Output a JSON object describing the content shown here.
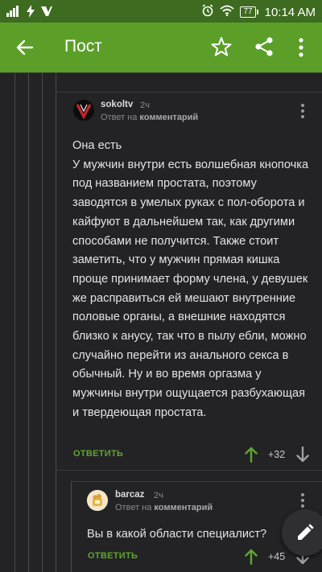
{
  "status_bar": {
    "battery": "77",
    "time": "10:14 AM"
  },
  "app_bar": {
    "title": "Пост"
  },
  "comments": [
    {
      "username": "sokoltv",
      "time": "2ч",
      "reply_prefix": "Ответ на",
      "reply_target": "комментарий",
      "text": "Она есть\nУ мужчин внутри есть волшебная кнопочка под названием простата, поэтому заводятся в умелых руках с пол-оборота и кайфуют в дальнейшем так, как другими способами не получится. Также стоит заметить, что у мужчин прямая кишка проще принимает форму члена, у девушек же расправиться ей мешают внутренние половые органы, а внешние находятся близко к анусу, так что в пылу ебли, можно случайно перейти из анального секса в обычный. Ну и во время оргазма у мужчины внутри ощущается разбухающая и твердеющая простата.",
      "reply_label": "ОТВЕТИТЬ",
      "score": "+32"
    },
    {
      "username": "barcaz",
      "time": "2ч",
      "reply_prefix": "Ответ на",
      "reply_target": "комментарий",
      "text": "Вы в какой области специалист?",
      "reply_label": "ОТВЕТИТЬ",
      "score": "+45"
    }
  ],
  "colors": {
    "status_bar": "#3d6b1f",
    "app_bar": "#5b9f29",
    "background": "#232325",
    "accent": "#5fa62d"
  },
  "icons": {
    "back": "arrow-left-icon",
    "bookmark": "star-outline-icon",
    "share": "share-icon",
    "menu": "more-vertical-icon",
    "fab": "pencil-icon"
  }
}
